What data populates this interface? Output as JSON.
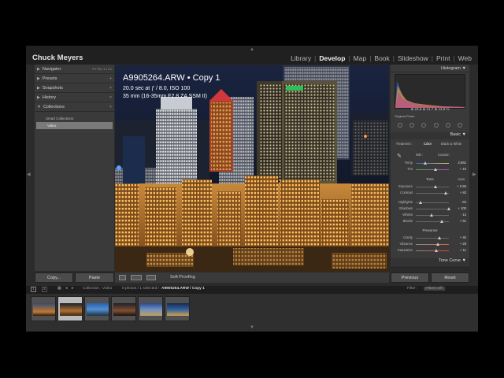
{
  "identity_plate": "Chuck Meyers",
  "modules": [
    {
      "label": "Library",
      "active": false
    },
    {
      "label": "Develop",
      "active": true
    },
    {
      "label": "Map",
      "active": false
    },
    {
      "label": "Book",
      "active": false
    },
    {
      "label": "Slideshow",
      "active": false
    },
    {
      "label": "Print",
      "active": false
    },
    {
      "label": "Web",
      "active": false
    }
  ],
  "left_panel": {
    "navigator": "Navigator",
    "navigator_zoom": "FIT FILL 1:1 3:1",
    "presets": "Presets",
    "snapshots": "Snapshots",
    "history": "History",
    "collections": "Collections",
    "smart_collections": "Smart Collections",
    "video_collection": "Video"
  },
  "left_buttons": {
    "copy": "Copy...",
    "paste": "Paste"
  },
  "photo_info": {
    "filename": "A9905264.ARW  •  Copy 1",
    "exposure": "20.0 sec at ƒ / 8.0, ISO 100",
    "lens": "35 mm (16-35mm F2.8 ZA SSM II)"
  },
  "toolbar": {
    "soft_proofing": "Soft Proofing"
  },
  "right_panel": {
    "histogram": "Histogram",
    "hist_meta": "⊕ 23.8   ⊕ 21.7   ⊕ 13.8 %",
    "original_photo": "Original Photo",
    "basic": "Basic",
    "treatment_label": "Treatment :",
    "treatment_color": "Color",
    "treatment_bw": "Black & White",
    "wb_label": "WB :",
    "wb_value": "Custom",
    "temp": {
      "label": "Temp",
      "value": "2,962"
    },
    "tint": {
      "label": "Tint",
      "value": "+ 10"
    },
    "tone": "Tone",
    "auto": "Auto",
    "exposure": {
      "label": "Exposure",
      "value": "+ 0.55"
    },
    "contrast": {
      "label": "Contrast",
      "value": "+ 83"
    },
    "highlights": {
      "label": "Highlights",
      "value": "- 84"
    },
    "shadows": {
      "label": "Shadows",
      "value": "+ 100"
    },
    "whites": {
      "label": "Whites",
      "value": "- 13"
    },
    "blacks": {
      "label": "Blacks",
      "value": "+ 51"
    },
    "presence": "Presence",
    "clarity": {
      "label": "Clarity",
      "value": "+ 40"
    },
    "vibrance": {
      "label": "Vibrance",
      "value": "+ 29"
    },
    "saturation": {
      "label": "Saturation",
      "value": "+ 11"
    },
    "tone_curve": "Tone Curve"
  },
  "right_buttons": {
    "previous": "Previous",
    "reset": "Reset"
  },
  "filmstrip": {
    "page1": "1",
    "page2": "2",
    "path": "Collection : Video",
    "count": "6 photos / 1 selected /",
    "selected_file": "A9905264.ARW / Copy 1",
    "filter_label": "Filter :",
    "filter_value": "Filters Off",
    "thumbnail_count": 6,
    "selected_index": 1
  },
  "colors": {
    "accent": "#f2f2f2",
    "panel": "#3a3a3a",
    "background": "#2b2b2b"
  }
}
